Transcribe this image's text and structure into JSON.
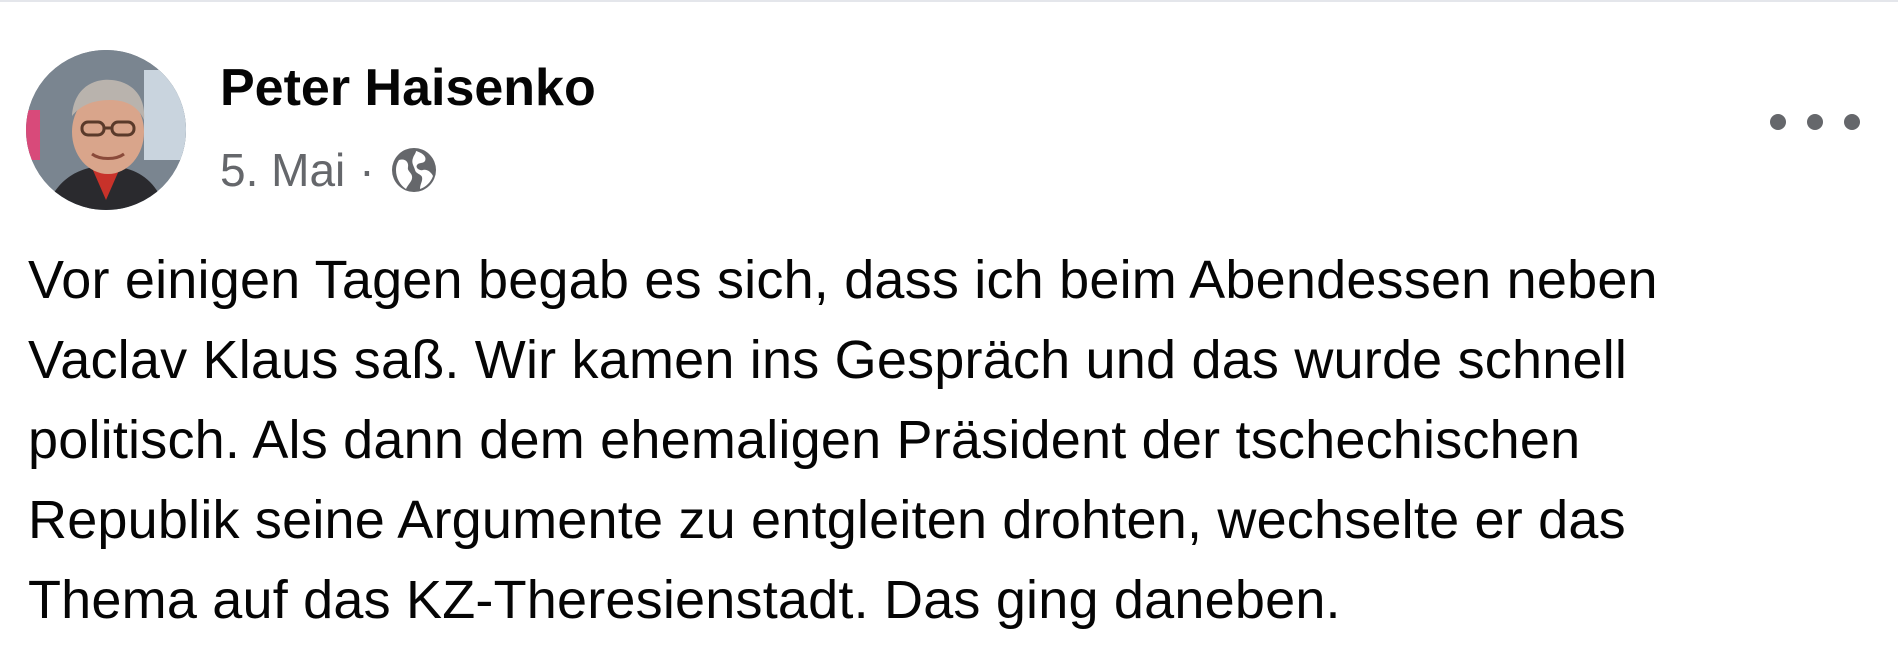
{
  "post": {
    "author": "Peter Haisenko",
    "date": "5. Mai",
    "separator": "·",
    "privacy_icon": "globe-icon",
    "more_icon": "more-options-icon",
    "text_lines": [
      "Vor einigen Tagen begab es sich, dass ich beim Abendessen neben",
      "Vaclav Klaus saß. Wir kamen ins Gespräch und das wurde schnell",
      "politisch. Als dann dem ehemaligen Präsident der tschechischen",
      "Republik seine Argumente zu entgleiten drohten, wechselte er das",
      "Thema auf das KZ-Theresienstadt. Das ging daneben."
    ]
  },
  "colors": {
    "text_primary": "#050505",
    "text_secondary": "#65676b",
    "divider": "#e4e6eb"
  }
}
